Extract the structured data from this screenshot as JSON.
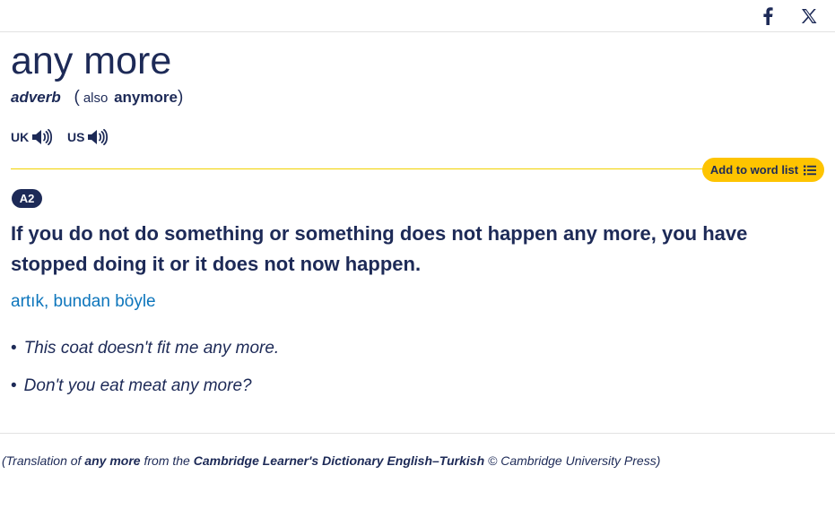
{
  "share": {
    "facebook_icon": "facebook-icon",
    "x_icon": "x-twitter-icon"
  },
  "entry": {
    "headword": "any more",
    "pos": "adverb",
    "paren_open": "(",
    "also_label": "also",
    "alt_form": "anymore",
    "paren_close": ")"
  },
  "pronunciation": {
    "uk_label": "UK",
    "us_label": "US",
    "audio_icon": "speaker-icon"
  },
  "wordlist": {
    "button_label": "Add to word list",
    "icon": "list-icon"
  },
  "sense": {
    "level": "A2",
    "definition": "If you do not do something or something does not happen any more, you have stopped doing it or it does not now happen.",
    "translation": "artık, bundan böyle",
    "examples": [
      "This coat doesn't fit me any more.",
      "Don't you eat meat any more?"
    ]
  },
  "credit": {
    "open": "(Translation of ",
    "term": "any more",
    "mid": " from the ",
    "source": "Cambridge Learner's Dictionary English–Turkish",
    "copyright": " © Cambridge University Press)"
  },
  "colors": {
    "navy": "#1d2a57",
    "link_blue": "#0e76bc",
    "yellow": "#fec400",
    "rule_yellow": "#f2d200"
  }
}
